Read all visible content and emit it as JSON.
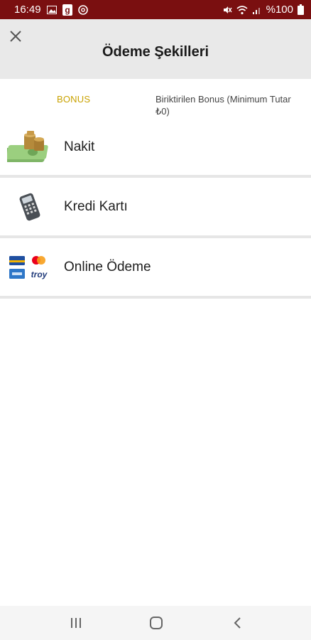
{
  "status_bar": {
    "time": "16:49",
    "battery": "%100",
    "background_color": "#7a0f10"
  },
  "header": {
    "title": "Ödeme Şekilleri",
    "close_icon": "close-icon"
  },
  "bonus": {
    "label": "BONUS",
    "info": "Biriktirilen Bonus (Minimum Tutar ₺0)",
    "label_color": "#c9a200"
  },
  "payment_methods": [
    {
      "label": "Nakit",
      "icon": "cash-icon"
    },
    {
      "label": "Kredi Kartı",
      "icon": "card-terminal-icon"
    },
    {
      "label": "Online Ödeme",
      "icon": "card-brands-icon",
      "brands": [
        "troy"
      ]
    }
  ],
  "nav_bar": {
    "buttons": [
      "recent-apps-icon",
      "home-icon",
      "back-icon"
    ]
  }
}
